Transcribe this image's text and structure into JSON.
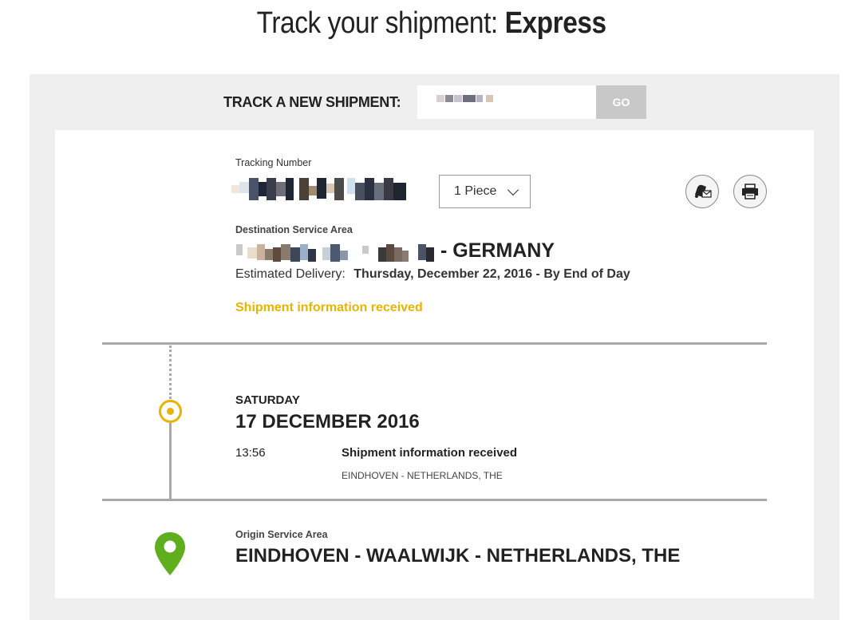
{
  "header": {
    "title_prefix": "Track your shipment:",
    "title_service": "Express"
  },
  "track_new": {
    "label": "TRACK A NEW SHIPMENT:",
    "go_label": "GO"
  },
  "shipment": {
    "tracking_number_label": "Tracking Number",
    "pieces_selected": "1 Piece",
    "destination_label": "Destination Service Area",
    "destination_country": "- GERMANY",
    "estimated_delivery_label": "Estimated Delivery:",
    "estimated_delivery_value": "Thursday, December 22, 2016 - By End of Day",
    "status": "Shipment information received"
  },
  "events": [
    {
      "day": "SATURDAY",
      "date": "17 DECEMBER 2016",
      "time": "13:56",
      "description": "Shipment information received",
      "location": "EINDHOVEN - NETHERLANDS, THE"
    }
  ],
  "origin": {
    "label": "Origin Service Area",
    "value": "EINDHOVEN - WAALWIJK - NETHERLANDS, THE"
  },
  "icons": {
    "notify": "bell-envelope-icon",
    "print": "printer-icon",
    "origin": "location-pin-icon"
  },
  "colors": {
    "accent_yellow": "#e8b400",
    "origin_green": "#5fae1e",
    "panel_bg": "#efefef",
    "go_button": "#c8c8c8"
  }
}
